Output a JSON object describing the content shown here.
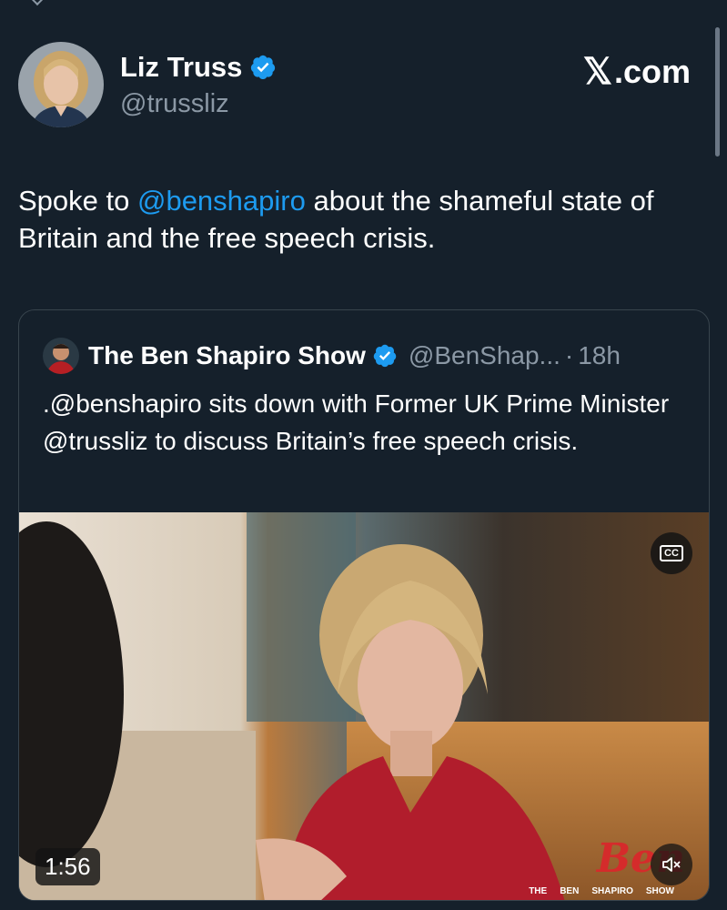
{
  "post": {
    "author": {
      "name": "Liz Truss",
      "handle": "@trussliz",
      "verified": true
    },
    "brand": {
      "mark": "𝕏",
      "text": ".com"
    },
    "text": {
      "before": "Spoke to ",
      "mention": "@benshapiro",
      "after": " about the shameful state of Britain and the free speech crisis."
    }
  },
  "quote": {
    "author": {
      "name": "The Ben Shapiro Show",
      "handle": "@BenShap...",
      "separator": "·",
      "time": "18h",
      "verified": true
    },
    "text": ".@benshapiro sits down with Former UK Prime Minister @trussliz to discuss Britain’s free speech crisis.",
    "video": {
      "duration": "1:56",
      "captions_label": "CC",
      "watermark": {
        "big": "Ben",
        "line": [
          "THE",
          "BEN",
          "SHAPIRO",
          "SHOW"
        ]
      }
    }
  },
  "colors": {
    "background": "#15202b",
    "accent": "#1d9bf0",
    "muted": "#8b98a5",
    "border": "#38444d"
  },
  "icons": [
    "chevron-down-icon",
    "verified-badge-icon",
    "captions-icon",
    "mute-icon"
  ]
}
